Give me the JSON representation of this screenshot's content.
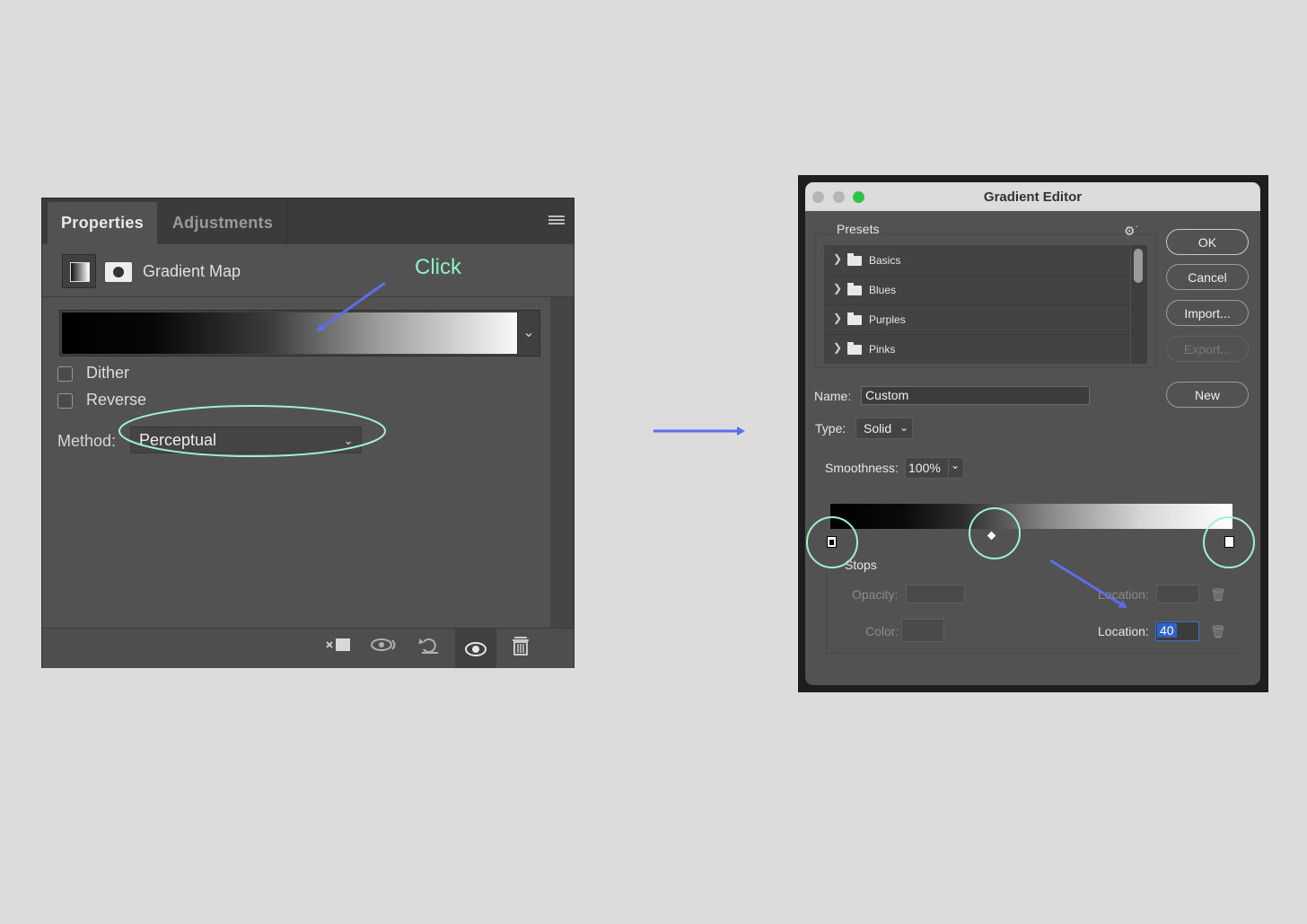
{
  "properties": {
    "tabs": [
      "Properties",
      "Adjustments"
    ],
    "adjustment_name": "Gradient Map",
    "checkboxes": [
      {
        "label": "Dither",
        "checked": false
      },
      {
        "label": "Reverse",
        "checked": false
      }
    ],
    "method_label": "Method:",
    "method_value": "Perceptual",
    "gradient": {
      "from": "#000000",
      "to": "#ffffff"
    },
    "footer_icons": [
      "clip-to-layer-icon",
      "view-previous-state-icon",
      "reset-icon",
      "visibility-eye-icon",
      "trash-icon"
    ]
  },
  "annotations": {
    "click_label": "Click",
    "arrow_color": "#5c6ee8",
    "circle_color": "#9ef3cd"
  },
  "editor": {
    "title": "Gradient Editor",
    "presets_label": "Presets",
    "presets": [
      "Basics",
      "Blues",
      "Purples",
      "Pinks"
    ],
    "buttons": {
      "ok": "OK",
      "cancel": "Cancel",
      "import": "Import...",
      "export": "Export...",
      "new": "New"
    },
    "name_label": "Name:",
    "name_value": "Custom",
    "type_label": "Type:",
    "type_value": "Solid",
    "smoothness_label": "Smoothness:",
    "smoothness_value": "100%",
    "stops_label": "Stops",
    "opacity_label": "Opacity:",
    "opacity_location_label": "Location:",
    "color_label": "Color:",
    "color_location_label": "Location:",
    "color_location_value": "40",
    "traffic_lights": [
      "#b5b5b5",
      "#b5b5b5",
      "#2fc446"
    ]
  }
}
